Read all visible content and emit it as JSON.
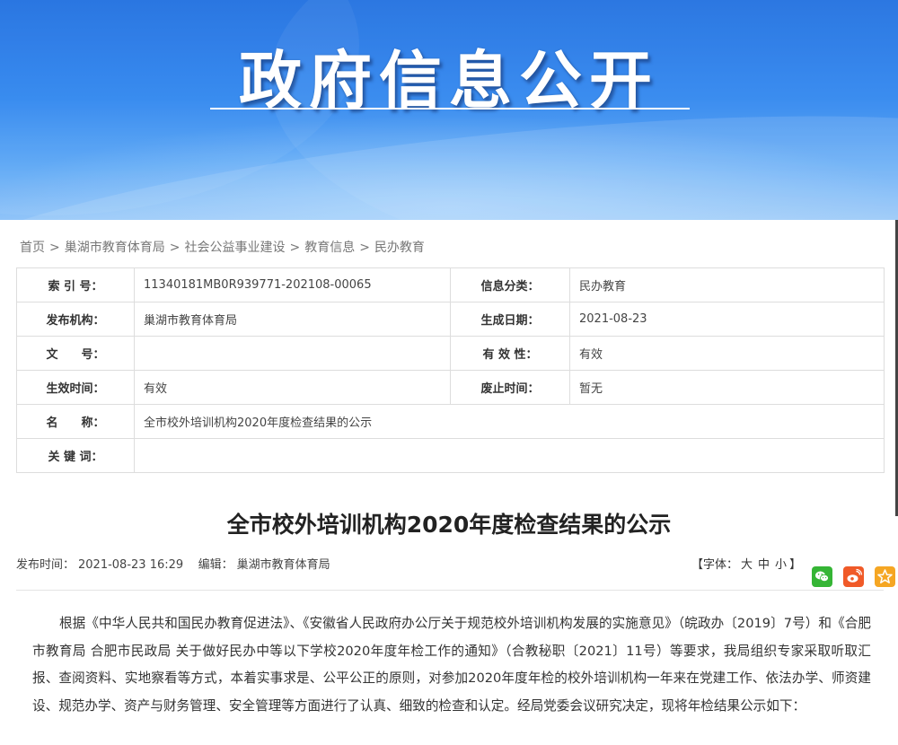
{
  "banner": {
    "title": "政府信息公开"
  },
  "breadcrumb": [
    "首页",
    "巢湖市教育体育局",
    "社会公益事业建设",
    "教育信息",
    "民办教育"
  ],
  "breadcrumb_sep": ">",
  "info": {
    "index_label": "索 引 号：",
    "index_value": "11340181MB0R939771-202108-00065",
    "category_label": "信息分类：",
    "category_value": "民办教育",
    "publisher_label": "发布机构：",
    "publisher_value": "巢湖市教育体育局",
    "created_label": "生成日期：",
    "created_value": "2021-08-23",
    "docno_label": "文　　号：",
    "docno_value": "",
    "validity_label": "有 效 性：",
    "validity_value": "有效",
    "effective_label": "生效时间：",
    "effective_value": "有效",
    "repeal_label": "废止时间：",
    "repeal_value": "暂无",
    "name_label": "名　　称：",
    "name_value": "全市校外培训机构2020年度检查结果的公示",
    "keywords_label": "关 键 词：",
    "keywords_value": ""
  },
  "article": {
    "title": "全市校外培训机构2020年度检查结果的公示",
    "publish_label": "发布时间：",
    "publish_time": "2021-08-23 16:29",
    "editor_label": "编辑：",
    "editor": "巢湖市教育体育局",
    "font_label": "【字体：",
    "font_large": "大",
    "font_medium": "中",
    "font_small": "小",
    "font_close": "】",
    "body": "根据《中华人民共和国民办教育促进法》、《安徽省人民政府办公厅关于规范校外培训机构发展的实施意见》（皖政办〔2019〕7号）和《合肥市教育局 合肥市民政局 关于做好民办中等以下学校2020年度年检工作的通知》（合教秘职〔2021〕11号）等要求，我局组织专家采取听取汇报、查阅资料、实地察看等方式，本着实事求是、公平公正的原则，对参加2020年度年检的校外培训机构一年来在党建工作、依法办学、师资建设、规范办学、资产与财务管理、安全管理等方面进行了认真、细致的检查和认定。经局党委会议研究决定，现将年检结果公示如下："
  },
  "colors": {
    "banner_top": "#1f6fe0",
    "banner_bottom": "#8fc3f8",
    "wechat": "#35b535",
    "weibo": "#f05a28",
    "favorite": "#f5a623"
  }
}
